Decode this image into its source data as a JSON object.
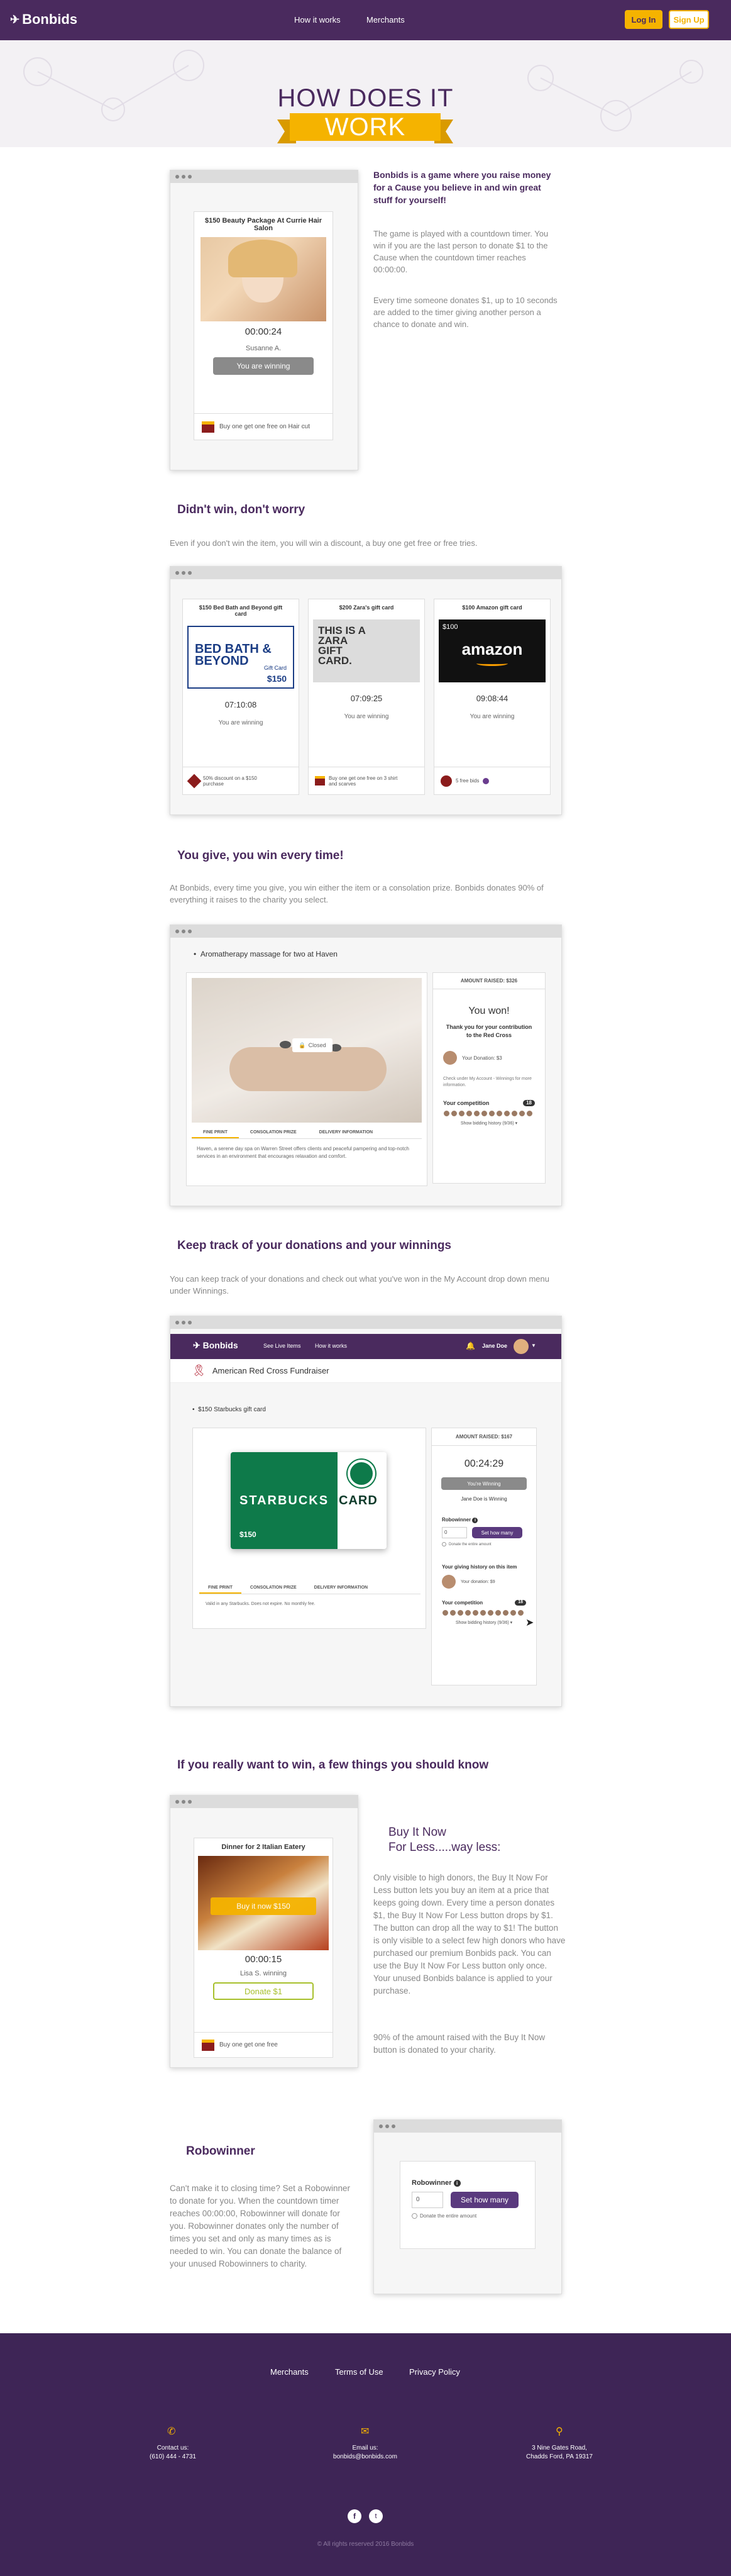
{
  "header": {
    "logo": "Bonbids",
    "nav": [
      "How it works",
      "Merchants"
    ],
    "login": "Log In",
    "signup": "Sign Up"
  },
  "hero": {
    "line1": "HOW DOES IT",
    "line2": "WORK"
  },
  "section1": {
    "item_title": "$150 Beauty Package At Currie Hair Salon",
    "timer": "00:00:24",
    "winner": "Susanne A.",
    "status_button": "You are winning",
    "footer_offer": "Buy one get one free on Hair cut",
    "bold": "Bonbids is a game where you raise money for a Cause you believe in and win great stuff for yourself!",
    "para1": "The game is played with a countdown timer. You win if you are the last person to donate $1 to the Cause when the countdown timer reaches 00:00:00.",
    "para2": "Every time someone donates $1, up to 10 seconds are added to the timer giving another person a chance to donate and win."
  },
  "section2": {
    "heading": "Didn't win, don't worry",
    "para": "Even if you don't win the item, you will win a discount, a buy one get free or free tries.",
    "cards": [
      {
        "title": "$150 Bed Bath and Beyond gift card",
        "timer": "07:10:08",
        "status": "You are winning",
        "offer": "50% discount on a $150 purchase",
        "brand": "BED BATH & BEYOND",
        "brand_sub": "Gift Card",
        "amount": "$150"
      },
      {
        "title": "$200 Zara's gift card",
        "timer": "07:09:25",
        "status": "You are winning",
        "offer": "Buy one get one free on 3 shirt and scarves",
        "brand": "THIS IS A ZARA GIFT CARD."
      },
      {
        "title": "$100 Amazon gift card",
        "timer": "09:08:44",
        "status": "You are winning",
        "offer": "5 free bids",
        "brand": "amazon",
        "amount": "$100"
      }
    ]
  },
  "section3": {
    "heading": "You give, you win every time!",
    "para": "At Bonbids, every time you give, you win either the item or a consolation prize. Bonbids donates 90% of everything it raises to the charity you select.",
    "item": "Aromatherapy massage for two at Haven",
    "closed": "Closed",
    "tabs": [
      "FINE PRINT",
      "CONSOLATION PRIZE",
      "DELIVERY INFORMATION"
    ],
    "desc": "Haven, a serene day spa on Warren Street offers clients and peaceful pampering and top-notch services in an environment that encourages relaxation and comfort.",
    "amount_raised": "AMOUNT RAISED: $326",
    "won": "You won!",
    "thanks": "Thank you for your contribution to the Red Cross",
    "donation": "Your Donation: $3",
    "check": "Check under My Account - Winnings for more information.",
    "competition": "Your competition",
    "competition_count": "18",
    "history": "Show bidding history (9/36)"
  },
  "section4": {
    "heading": "Keep track of your donations and your winnings",
    "para": "You can keep track of your donations and check out what you've won in the My Account drop down menu under Winnings.",
    "app_nav": [
      "See Live Items",
      "How it works"
    ],
    "user": "Jane Doe",
    "fundraiser": "American Red Cross Fundraiser",
    "item": "$150 Starbucks gift card",
    "card_brand": "STARBUCKS",
    "card_word": "CARD",
    "card_amount": "$150",
    "tabs": [
      "FINE PRINT",
      "CONSOLATION PRIZE",
      "DELIVERY INFORMATION"
    ],
    "desc": "Valid in any Starbucks. Does not expire. No monthly fee.",
    "amount_raised": "AMOUNT RAISED: $167",
    "timer": "00:24:29",
    "winning_btn": "You're Winning",
    "winner": "Jane Doe is Winning",
    "robowinner": "Robowinner",
    "qty": "0",
    "set_btn": "Set how many",
    "donate_all": "Donate the entire amount",
    "giving_history": "Your giving history on this item",
    "your_donation": "Your donation: $9",
    "competition": "Your competition",
    "competition_count": "18",
    "history": "Show bidding history (9/36)"
  },
  "section5": {
    "heading": "If you really want to win, a few things you should know",
    "item_title": "Dinner for 2 Italian Eatery",
    "buy_now": "Buy it now $150",
    "timer": "00:00:15",
    "winner": "Lisa S. winning",
    "donate_btn": "Donate $1",
    "offer": "Buy one get one free",
    "title1": "Buy It Now",
    "title2": "For Less.....way less:",
    "para1": "Only visible to high donors, the Buy It Now For Less button lets you buy an item at a price that keeps going down. Every time a person donates $1, the Buy It Now For Less button drops by $1. The button can drop all the way to $1! The button is only visible to a select few high donors who have purchased our premium Bonbids pack. You can use the Buy It Now For Less button only once. Your unused Bonbids balance is applied to your purchase.",
    "para2": "90% of the amount raised with the Buy It Now button is donated to your charity."
  },
  "section6": {
    "heading": "Robowinner",
    "para": "Can't make it to closing time? Set a Robowinner to donate for you. When the countdown timer reaches 00:00:00, Robowinner will donate for you. Robowinner donates only the number of times you set and only as many times as is needed to win. You can donate the balance of your unused Robowinners to charity.",
    "label": "Robowinner",
    "qty": "0",
    "set_btn": "Set how many",
    "donate_all": "Donate the entire amount"
  },
  "footer": {
    "links": [
      "Merchants",
      "Terms of Use",
      "Privacy Policy"
    ],
    "contact_label": "Contact us:",
    "phone": "(610) 444 - 4731",
    "email_label": "Email us:",
    "email": "bonbids@bonbids.com",
    "address1": "3 Nine Gates Road,",
    "address2": "Chadds Ford, PA 19317",
    "copyright": "© All rights reserved 2016 Bonbids"
  },
  "colors": {
    "purple": "#4a2a5e",
    "yellow": "#f5b300",
    "footer": "#3e2556"
  }
}
